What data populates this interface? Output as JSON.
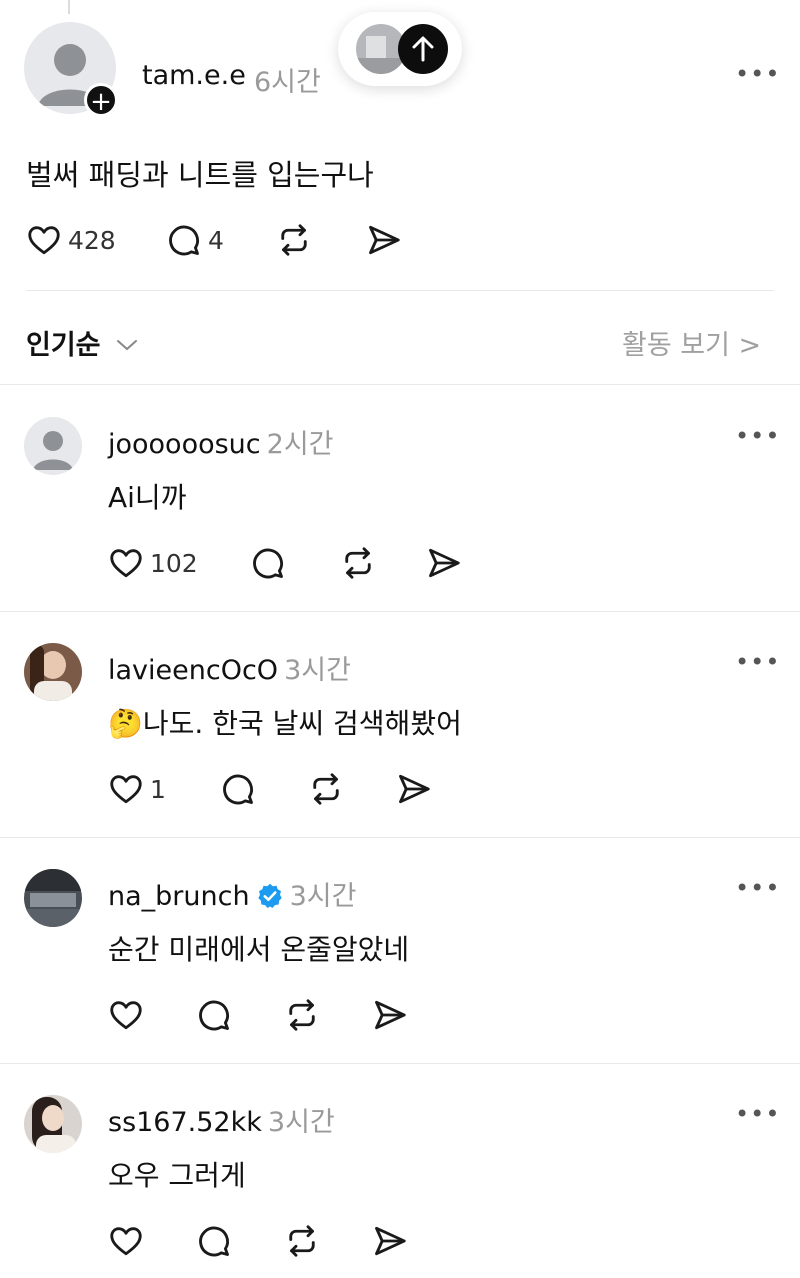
{
  "post": {
    "username": "tam.e.e",
    "time": "6시간",
    "text": "벌써 패딩과 니트를 입는구나",
    "likes": "428",
    "replies": "4",
    "follow_icon": "plus-icon"
  },
  "sort": {
    "label": "인기순",
    "activity_label": "활동 보기 >"
  },
  "comments": [
    {
      "username": "joooooosuc",
      "time": "2시간",
      "text": "Ai니까",
      "likes": "102"
    },
    {
      "username": "lavieencOcO",
      "time": "3시간",
      "text": "나도. 한국 날씨 검색해봤어",
      "emoji": "🤔",
      "likes": "1"
    },
    {
      "username": "na_brunch",
      "time": "3시간",
      "text": "순간 미래에서 온줄알았네",
      "verified": true,
      "likes": ""
    },
    {
      "username": "ss167.52kk",
      "time": "3시간",
      "text": "오우 그러게",
      "likes": ""
    }
  ],
  "colors": {
    "verified": "#1d9bf0",
    "muted": "#9a9a9a",
    "text": "#111111"
  }
}
